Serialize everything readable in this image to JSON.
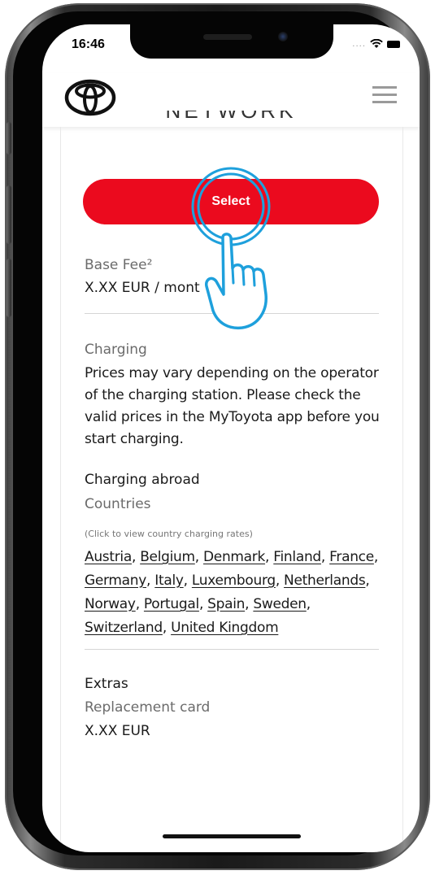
{
  "status_bar": {
    "time": "16:46",
    "signal_dots": "...."
  },
  "header": {
    "logo_icon": "toyota-logo-icon",
    "menu_icon": "hamburger-menu-icon"
  },
  "plan": {
    "title_fragment": "NETWORK",
    "select_label": "Select"
  },
  "base_fee": {
    "label": "Base Fee²",
    "value": "X.XX EUR / mont"
  },
  "charging": {
    "label": "Charging",
    "description": "Prices may vary depending on the operator of the charging station. Please check the valid prices in the MyToyota app before you start charging."
  },
  "charging_abroad": {
    "label": "Charging abroad",
    "countries_label": "Countries",
    "note": "(Click to view country charging rates)",
    "countries": [
      "Austria",
      "Belgium",
      "Denmark",
      "Finland",
      "France",
      "Germany",
      "Italy",
      "Luxembourg",
      "Netherlands",
      "Norway",
      "Portugal",
      "Spain",
      "Sweden",
      "Switzerland",
      "United Kingdom"
    ]
  },
  "extras": {
    "label": "Extras",
    "item_label": "Replacement card",
    "item_value": "X.XX EUR"
  },
  "colors": {
    "accent": "#eb0a1e",
    "tap_hint": "#1ea0dc"
  }
}
